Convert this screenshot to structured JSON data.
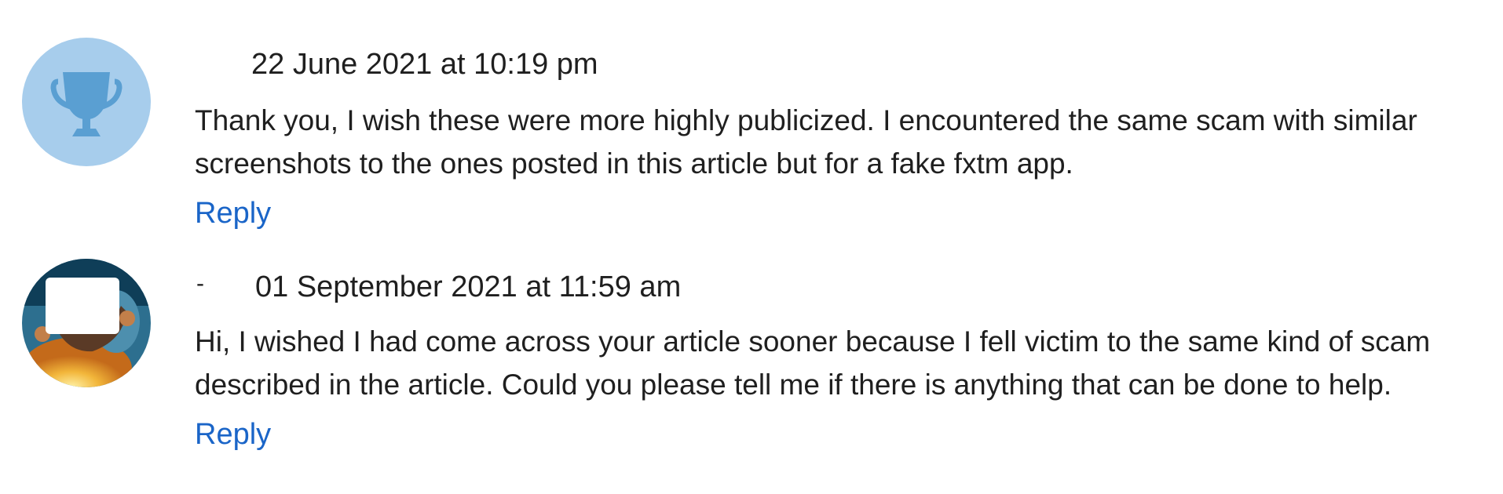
{
  "comments": [
    {
      "avatar_icon": "trophy-icon",
      "date": "22 June 2021 at 10:19 pm",
      "author": "",
      "text": "Thank you, I wish these were more highly publicized. I encountered the same scam with similar screenshots to the ones posted in this article but for a fake fxtm app.",
      "reply_label": "Reply"
    },
    {
      "avatar_icon": "user-photo",
      "date": "01 September 2021 at 11:59 am",
      "author": "-",
      "text": "Hi, I wished I had come across your article sooner because I fell victim to the same kind of scam described in the article. Could you please tell me if there is anything that can be done to help.",
      "reply_label": "Reply"
    }
  ],
  "colors": {
    "link": "#1a65c8",
    "text": "#1f1f1f",
    "avatar_bg": "#a7cdec",
    "trophy": "#5a9fd2"
  }
}
